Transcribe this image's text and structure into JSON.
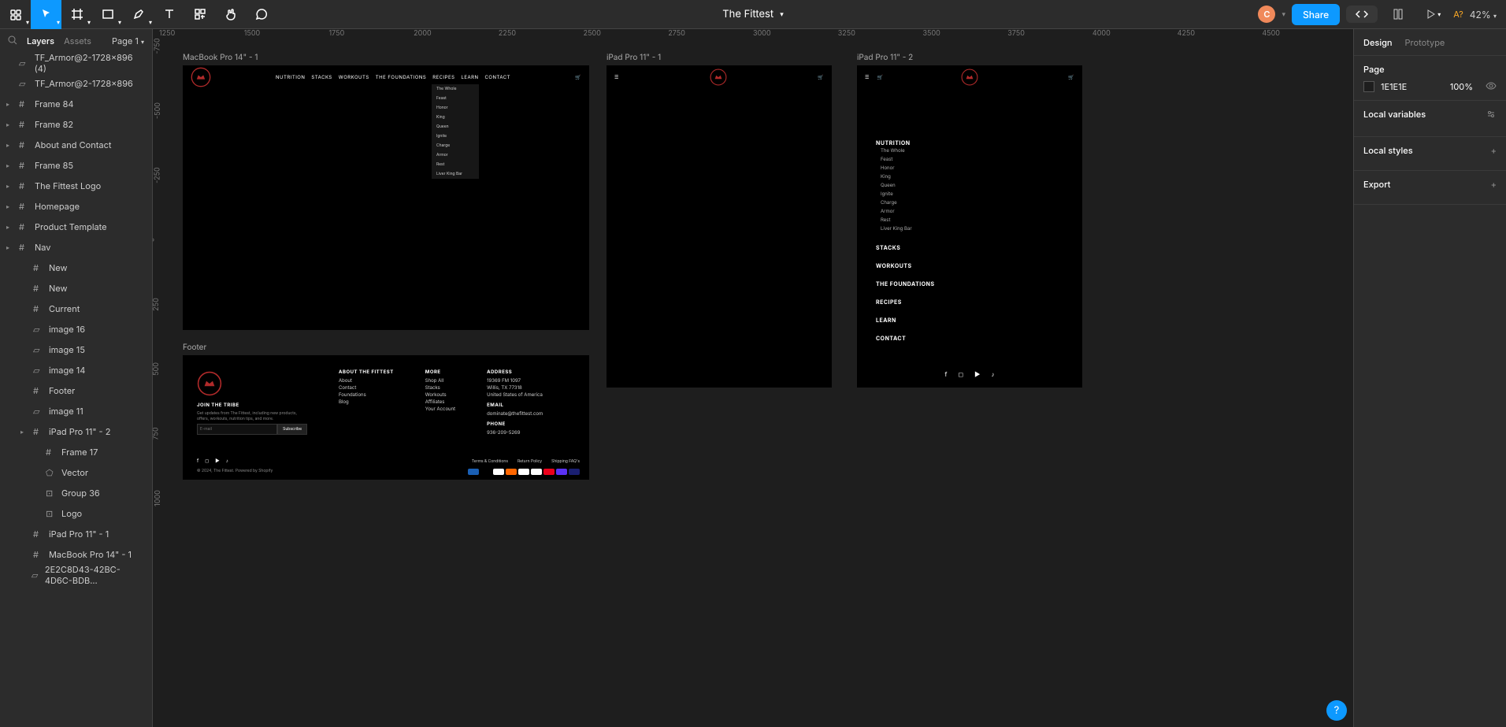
{
  "document": {
    "title": "The Fittest"
  },
  "toolbar": {
    "avatar_initial": "C",
    "share": "Share",
    "zoom": "42%",
    "a_question": "A?"
  },
  "left_panel": {
    "tabs": {
      "layers": "Layers",
      "assets": "Assets"
    },
    "page": "Page 1",
    "layers": [
      {
        "name": "TF_Armor@2-1728×896 (4)",
        "icon": "image",
        "depth": 0
      },
      {
        "name": "TF_Armor@2-1728×896",
        "icon": "image",
        "depth": 0
      },
      {
        "name": "Frame 84",
        "icon": "frame",
        "depth": 0,
        "exp": true
      },
      {
        "name": "Frame 82",
        "icon": "frame",
        "depth": 0,
        "exp": true
      },
      {
        "name": "About and Contact",
        "icon": "frame",
        "depth": 0,
        "exp": true
      },
      {
        "name": "Frame 85",
        "icon": "frame",
        "depth": 0,
        "exp": true
      },
      {
        "name": "The Fittest Logo",
        "icon": "frame",
        "depth": 0,
        "exp": true
      },
      {
        "name": "Homepage",
        "icon": "frame",
        "depth": 0,
        "exp": true
      },
      {
        "name": "Product Template",
        "icon": "frame",
        "depth": 0,
        "exp": true
      },
      {
        "name": "Nav",
        "icon": "frame",
        "depth": 0,
        "exp": true
      },
      {
        "name": "New",
        "icon": "frame",
        "depth": 1
      },
      {
        "name": "New",
        "icon": "frame",
        "depth": 1
      },
      {
        "name": "Current",
        "icon": "frame",
        "depth": 1
      },
      {
        "name": "image 16",
        "icon": "image",
        "depth": 1
      },
      {
        "name": "image 15",
        "icon": "image",
        "depth": 1
      },
      {
        "name": "image 14",
        "icon": "image",
        "depth": 1
      },
      {
        "name": "Footer",
        "icon": "frame",
        "depth": 1
      },
      {
        "name": "image 11",
        "icon": "image",
        "depth": 1
      },
      {
        "name": "iPad Pro 11\" - 2",
        "icon": "frame",
        "depth": 1,
        "exp": true
      },
      {
        "name": "Frame 17",
        "icon": "frame",
        "depth": 2
      },
      {
        "name": "Vector",
        "icon": "vector",
        "depth": 2
      },
      {
        "name": "Group 36",
        "icon": "group",
        "depth": 2
      },
      {
        "name": "Logo",
        "icon": "group",
        "depth": 2
      },
      {
        "name": "iPad Pro 11\" - 1",
        "icon": "frame",
        "depth": 1
      },
      {
        "name": "MacBook Pro 14\" - 1",
        "icon": "frame",
        "depth": 1
      },
      {
        "name": "2E2C8D43-42BC-4D6C-BDB...",
        "icon": "image",
        "depth": 1
      }
    ]
  },
  "right_panel": {
    "tabs": {
      "design": "Design",
      "prototype": "Prototype"
    },
    "page_section": {
      "title": "Page",
      "color": "1E1E1E",
      "opacity": "100%"
    },
    "local_vars": "Local variables",
    "local_styles": "Local styles",
    "export": "Export"
  },
  "ruler_h": [
    "1250",
    "1500",
    "1750",
    "2000",
    "2250",
    "2500",
    "2750",
    "3000",
    "3250",
    "3500",
    "3750",
    "4000",
    "4250",
    "4500"
  ],
  "ruler_v": [
    "-750",
    "-500",
    "-250",
    "0",
    "250",
    "500",
    "750",
    "1000"
  ],
  "canvas": {
    "frame1_label": "MacBook Pro 14\" - 1",
    "frame2_label": "iPad Pro 11\" - 1",
    "frame3_label": "iPad Pro 11\" - 2",
    "footer_label": "Footer",
    "nav_desktop": [
      "NUTRITION",
      "STACKS",
      "WORKOUTS",
      "THE FOUNDATIONS",
      "RECIPES",
      "LEARN",
      "CONTACT"
    ],
    "nutrition_sub": [
      "The Whole",
      "Feast",
      "Honor",
      "King",
      "Queen",
      "Ignite",
      "Charge",
      "Armor",
      "Rest",
      "Liver King Bar"
    ],
    "mobile_cats": [
      "NUTRITION",
      "STACKS",
      "WORKOUTS",
      "THE FOUNDATIONS",
      "RECIPES",
      "LEARN",
      "CONTACT"
    ],
    "footer": {
      "about_h": "ABOUT THE FITTEST",
      "about": [
        "About",
        "Contact",
        "Foundations",
        "Blog"
      ],
      "more_h": "MORE",
      "more": [
        "Shop All",
        "Stacks",
        "Workouts",
        "Affiliates",
        "Your Account"
      ],
      "addr_h": "ADDRESS",
      "addr": [
        "19369 FM 1097",
        "Willis, TX 77318",
        "United States of America"
      ],
      "email_h": "EMAIL",
      "email": "dominate@thefittest.com",
      "phone_h": "PHONE",
      "phone": "936-209-5269",
      "join_h": "JOIN THE TRIBE",
      "join_sub": "Get updates from The Fittest, including new products, offers, workouts, nutrition tips, and more.",
      "email_ph": "E-mail",
      "subscribe": "Subscribe",
      "links": {
        "terms": "Terms & Conditions",
        "return": "Return Policy",
        "shipping": "Shipping FAQ's"
      },
      "copyright": "© 2024, The Fittest. Powered by Shopify"
    }
  },
  "help": "?"
}
